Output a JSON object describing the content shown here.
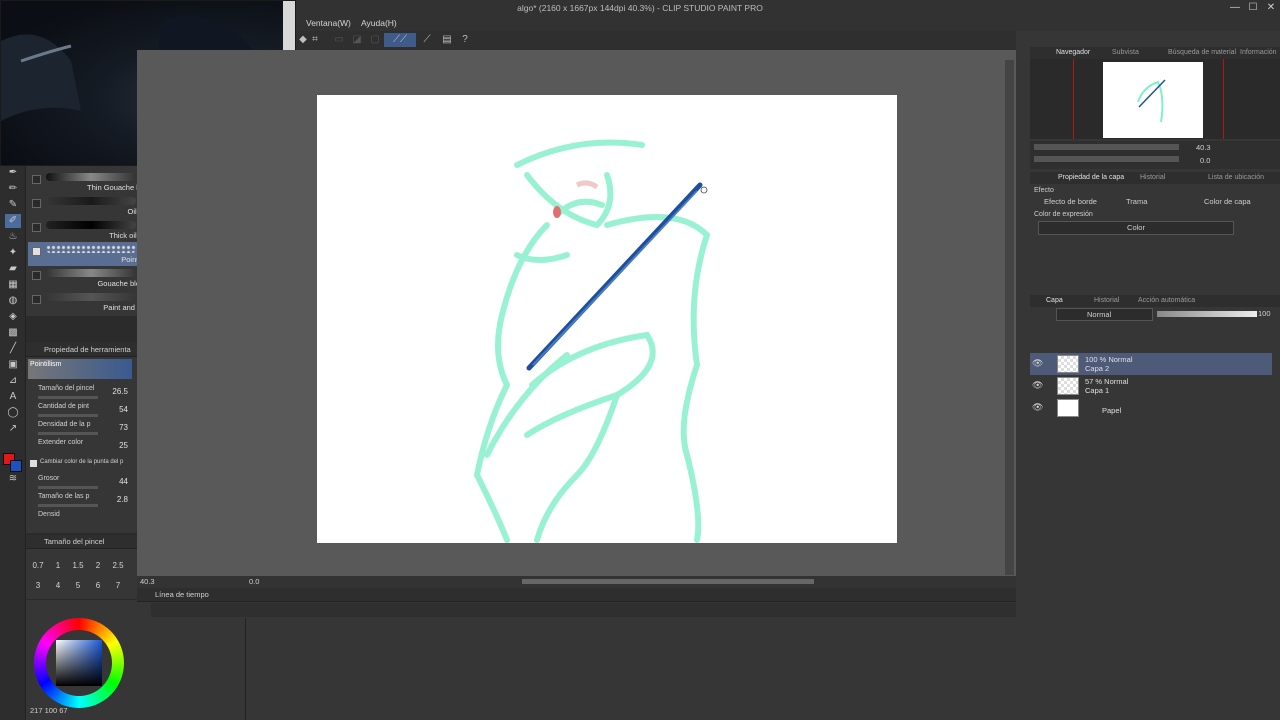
{
  "window": {
    "title": "algo* (2160 x 1667px 144dpi 40.3%)  - CLIP STUDIO PAINT PRO",
    "minimize": "—",
    "maximize": "☐",
    "close": "✕"
  },
  "menu": [
    "Ventana(W)",
    "Ayuda(H)"
  ],
  "subtools": {
    "items": [
      {
        "label": "Thin Gouache brush",
        "checked": false
      },
      {
        "label": "Oil paint",
        "checked": false
      },
      {
        "label": "Thick oil paint",
        "checked": false
      },
      {
        "label": "Pointillism",
        "checked": true
      },
      {
        "label": "Gouache blender",
        "checked": false
      },
      {
        "label": "Paint and apply",
        "checked": false
      }
    ]
  },
  "tool_property": {
    "header": "Propiedad de herramienta",
    "preset": "Pointillism",
    "rows": [
      {
        "label": "Tamaño del pincel",
        "value": "26.5"
      },
      {
        "label": "Cantidad de pint",
        "value": "54"
      },
      {
        "label": "Densidad de la p",
        "value": "73"
      },
      {
        "label": "Extender color",
        "value": "25"
      },
      {
        "label": "Cambiar color de la punta del p",
        "value": ""
      },
      {
        "label": "Grosor",
        "value": "44"
      },
      {
        "label": "Tamaño de las p",
        "value": "2.8"
      },
      {
        "label": "Densid",
        "value": ""
      }
    ]
  },
  "brush_size": {
    "header": "Tamaño del pincel",
    "sizes": [
      "0.7",
      "1",
      "1.5",
      "2",
      "2.5"
    ],
    "sizes2": [
      "3",
      "4",
      "5",
      "6",
      "7"
    ]
  },
  "color": {
    "main": "#e01818",
    "sub": "#2050c0",
    "readout": "217 100 67"
  },
  "canvas": {
    "zoom": "40.3",
    "rotation": "0.0"
  },
  "timeline": {
    "header": "Línea de tiempo"
  },
  "navigator": {
    "tabs": [
      "Navegador",
      "Subvista",
      "Búsqueda de material",
      "Información"
    ],
    "zoom": "40.3",
    "rotation": "0.0"
  },
  "layer_property": {
    "tabs": [
      "Propiedad de la capa",
      "Historial",
      "Lista de ubicación"
    ],
    "effect_label": "Efecto",
    "effects": [
      "Efecto de borde",
      "Trama",
      "Color de capa"
    ],
    "expression_label": "Color de expresión",
    "expression_value": "Color"
  },
  "layers": {
    "tabs": [
      "Capa",
      "Historial",
      "Acción automática"
    ],
    "blend_mode": "Normal",
    "opacity": "100",
    "items": [
      {
        "mode": "100 % Normal",
        "name": "Capa 2",
        "selected": true
      },
      {
        "mode": "57 % Normal",
        "name": "Capa 1",
        "selected": false
      },
      {
        "mode": "",
        "name": "Papel",
        "selected": false
      }
    ]
  }
}
